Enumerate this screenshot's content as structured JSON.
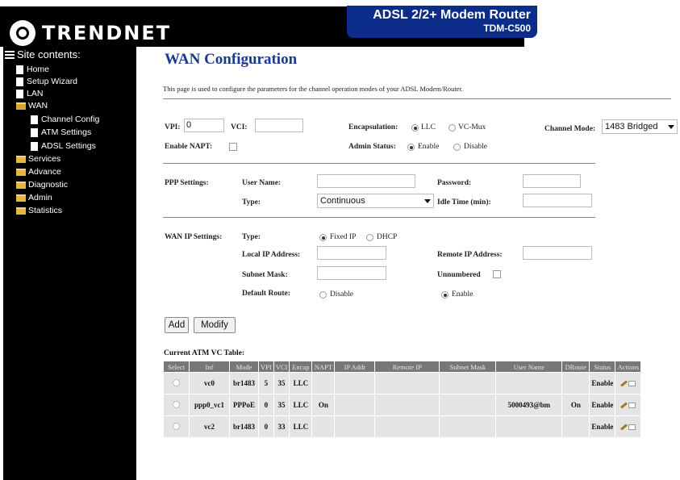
{
  "header": {
    "logo_text": "TRENDNET",
    "product_title": "ADSL 2/2+ Modem Router",
    "product_model": "TDM-C500"
  },
  "sidebar": {
    "title": "Site contents:",
    "items": [
      {
        "label": "Home",
        "icon": "doc-icon"
      },
      {
        "label": "Setup Wizard",
        "icon": "doc-icon"
      },
      {
        "label": "LAN",
        "icon": "doc-icon"
      },
      {
        "label": "WAN",
        "icon": "folder-open-icon"
      },
      {
        "label": "Channel Config",
        "icon": "doc-icon"
      },
      {
        "label": "ATM Settings",
        "icon": "doc-icon"
      },
      {
        "label": "ADSL Settings",
        "icon": "doc-icon"
      },
      {
        "label": "Services",
        "icon": "folder-icon"
      },
      {
        "label": "Advance",
        "icon": "folder-icon"
      },
      {
        "label": "Diagnostic",
        "icon": "folder-icon"
      },
      {
        "label": "Admin",
        "icon": "folder-icon"
      },
      {
        "label": "Statistics",
        "icon": "folder-icon"
      }
    ]
  },
  "page": {
    "title": "WAN Configuration",
    "description": "This page is used to configure the parameters for the channel operation modes of your ADSL Modem/Router."
  },
  "channel": {
    "vpi_label": "VPI:",
    "vpi_value": "0",
    "vci_label": "VCI:",
    "vci_value": "",
    "encap_label": "Encapsulation:",
    "encap_llc": "LLC",
    "encap_vcmux": "VC-Mux",
    "encap_selected": "LLC",
    "channel_mode_label": "Channel Mode:",
    "channel_mode_value": "1483 Bridged",
    "enable_napt_label": "Enable NAPT:",
    "admin_status_label": "Admin Status:",
    "admin_enable": "Enable",
    "admin_disable": "Disable",
    "admin_selected": "Enable"
  },
  "ppp": {
    "section_label": "PPP Settings:",
    "username_label": "User Name:",
    "username_value": "",
    "password_label": "Password:",
    "password_value": "",
    "type_label": "Type:",
    "type_value": "Continuous",
    "idle_label": "Idle Time (min):",
    "idle_value": ""
  },
  "wanip": {
    "section_label": "WAN IP Settings:",
    "type_label": "Type:",
    "fixed_ip": "Fixed IP",
    "dhcp": "DHCP",
    "type_selected": "Fixed IP",
    "local_ip_label": "Local IP Address:",
    "remote_ip_label": "Remote IP Address:",
    "subnet_label": "Subnet Mask:",
    "unnumbered_label": "Unnumbered",
    "default_route_label": "Default Route:",
    "route_disable": "Disable",
    "route_enable": "Enable",
    "route_selected": "Enable"
  },
  "buttons": {
    "add": "Add",
    "modify": "Modify"
  },
  "table": {
    "title": "Current ATM VC Table:",
    "columns": [
      "Select",
      "Inf",
      "Mode",
      "VPI",
      "VCI",
      "Encap",
      "NAPT",
      "IP Addr",
      "Remote IP",
      "Subnet Mask",
      "User Name",
      "DRoute",
      "Status",
      "Actions"
    ],
    "rows": [
      {
        "inf": "vc0",
        "mode": "br1483",
        "vpi": "5",
        "vci": "35",
        "encap": "LLC",
        "napt": "",
        "ip": "",
        "remote": "",
        "mask": "",
        "user": "",
        "droute": "",
        "status": "Enable"
      },
      {
        "inf": "ppp0_vc1",
        "mode": "PPPoE",
        "vpi": "0",
        "vci": "35",
        "encap": "LLC",
        "napt": "On",
        "ip": "",
        "remote": "",
        "mask": "",
        "user": "5000493@bm",
        "droute": "On",
        "status": "Enable"
      },
      {
        "inf": "vc2",
        "mode": "br1483",
        "vpi": "0",
        "vci": "33",
        "encap": "LLC",
        "napt": "",
        "ip": "",
        "remote": "",
        "mask": "",
        "user": "",
        "droute": "",
        "status": "Enable"
      }
    ]
  }
}
